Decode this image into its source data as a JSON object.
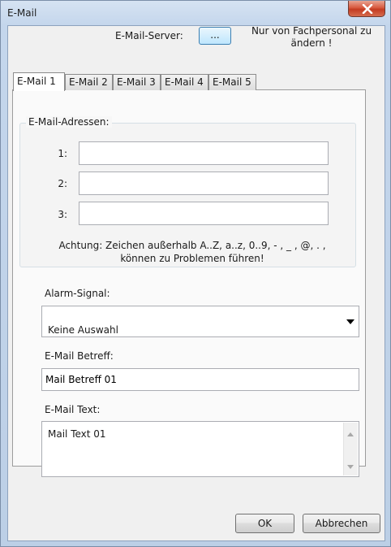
{
  "window": {
    "title": "E-Mail"
  },
  "header": {
    "server_label": "E-Mail-Server:",
    "server_button": "...",
    "server_note": "Nur von Fachpersonal zu ändern !"
  },
  "tabs": [
    {
      "label": "E-Mail 1",
      "active": true
    },
    {
      "label": "E-Mail 2",
      "active": false
    },
    {
      "label": "E-Mail 3",
      "active": false
    },
    {
      "label": "E-Mail 4",
      "active": false
    },
    {
      "label": "E-Mail 5",
      "active": false
    }
  ],
  "addresses": {
    "title": "E-Mail-Adressen:",
    "rows": [
      {
        "label": "1:",
        "value": ""
      },
      {
        "label": "2:",
        "value": ""
      },
      {
        "label": "3:",
        "value": ""
      }
    ],
    "warning_line1": "Achtung: Zeichen außerhalb A..Z, a..z, 0..9, - , _ , @, . ,",
    "warning_line2": "können zu Problemen führen!"
  },
  "alarm": {
    "label": "Alarm-Signal:",
    "value": "Keine Auswahl"
  },
  "subject": {
    "label": "E-Mail Betreff:",
    "value": "Mail Betreff 01"
  },
  "body_text": {
    "label": "E-Mail Text:",
    "value": "Mail Text 01"
  },
  "buttons": {
    "ok": "OK",
    "cancel": "Abbrechen"
  },
  "colors": {
    "close_button": "#c33b22",
    "server_button_border": "#3c7fb1",
    "frame": "#bccfe6"
  }
}
